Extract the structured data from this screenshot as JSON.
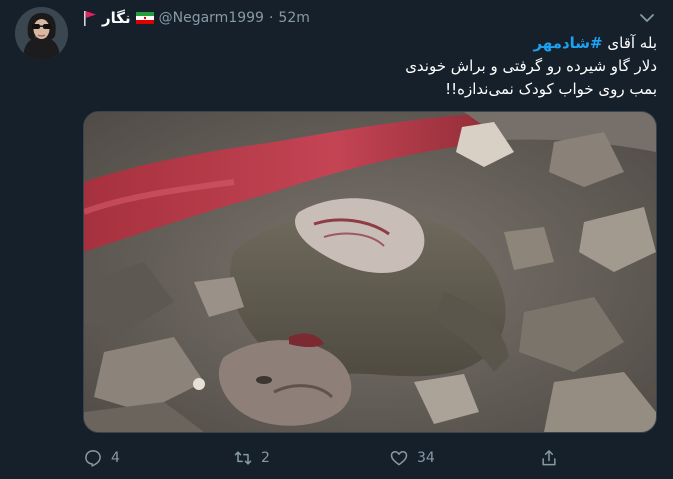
{
  "tweet": {
    "author": {
      "display_name": "نگار",
      "handle": "@Negarm1999",
      "separator": "·",
      "time": "52m"
    },
    "text": {
      "line1_prefix": "بله آقای ",
      "hashtag": "#شادمهر",
      "line2": "دلار گاو شیرده رو گرفتی و براش خوندی",
      "line3": "بمب روی خواب کودک نمی‌ندازه!!"
    },
    "media": {
      "icon": "photo"
    },
    "stats": {
      "replies": "4",
      "retweets": "2",
      "likes": "34"
    }
  },
  "colors": {
    "background": "#15202b",
    "primary_text": "#ffffff",
    "secondary_text": "#8899a6",
    "link": "#1da1f2",
    "border": "#38444d"
  },
  "icons": {
    "more": "chevron-down-icon",
    "reply": "reply-icon",
    "retweet": "retweet-icon",
    "like": "heart-icon",
    "share": "share-icon"
  }
}
